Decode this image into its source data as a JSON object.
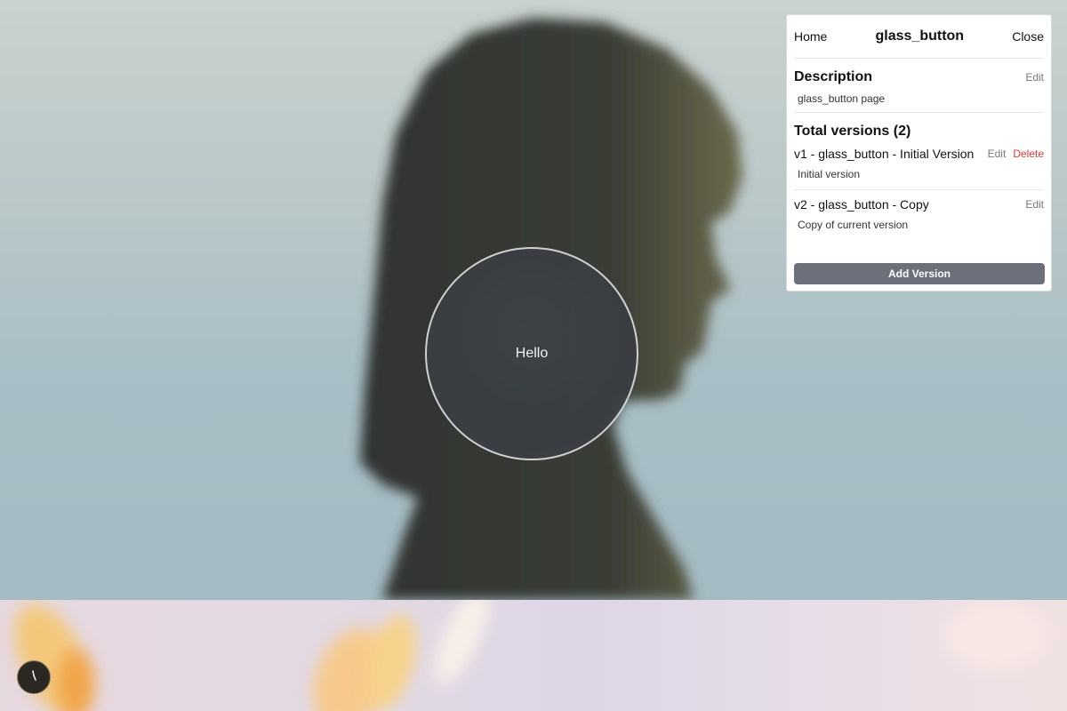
{
  "glass_button": {
    "label": "Hello"
  },
  "panel": {
    "home_label": "Home",
    "title": "glass_button",
    "close_label": "Close",
    "description": {
      "heading": "Description",
      "edit_label": "Edit",
      "text": "glass_button page"
    },
    "versions": {
      "heading": "Total versions (2)",
      "items": [
        {
          "name": "v1 - glass_button - Initial Version",
          "note": "Initial version",
          "edit_label": "Edit",
          "delete_label": "Delete"
        },
        {
          "name": "v2 - glass_button - Copy",
          "note": "Copy of current version",
          "edit_label": "Edit"
        }
      ]
    },
    "add_label": "Add Version"
  },
  "corner_control": {
    "icon": "clock-icon"
  },
  "colors": {
    "danger": "#e53935",
    "add_button": "#6b707b",
    "glass_fill": "#3e4446"
  }
}
